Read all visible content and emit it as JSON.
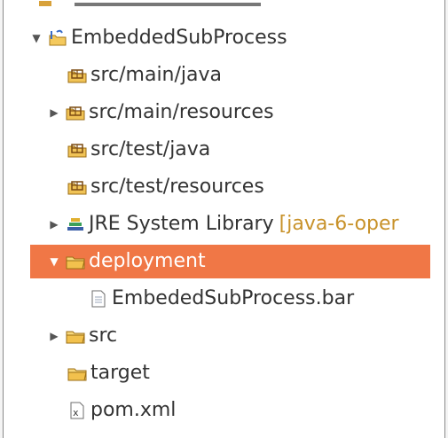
{
  "tree": {
    "project": {
      "label": "EmbeddedSubProcess",
      "icon": "java-project-icon"
    },
    "items": [
      {
        "label": "src/main/java",
        "icon": "package-folder-icon"
      },
      {
        "label": "src/main/resources",
        "icon": "package-folder-icon"
      },
      {
        "label": "src/test/java",
        "icon": "package-folder-icon"
      },
      {
        "label": "src/test/resources",
        "icon": "package-folder-icon"
      },
      {
        "label": "JRE System Library",
        "decoration": "[java-6-oper",
        "icon": "library-icon"
      },
      {
        "label": "deployment",
        "icon": "folder-icon"
      },
      {
        "label": "EmbededSubProcess.bar",
        "icon": "file-icon"
      },
      {
        "label": "src",
        "icon": "folder-icon"
      },
      {
        "label": "target",
        "icon": "folder-icon"
      },
      {
        "label": "pom.xml",
        "icon": "xml-file-icon"
      }
    ]
  },
  "colors": {
    "selection": "#f07746",
    "folder": "#e3a628"
  }
}
